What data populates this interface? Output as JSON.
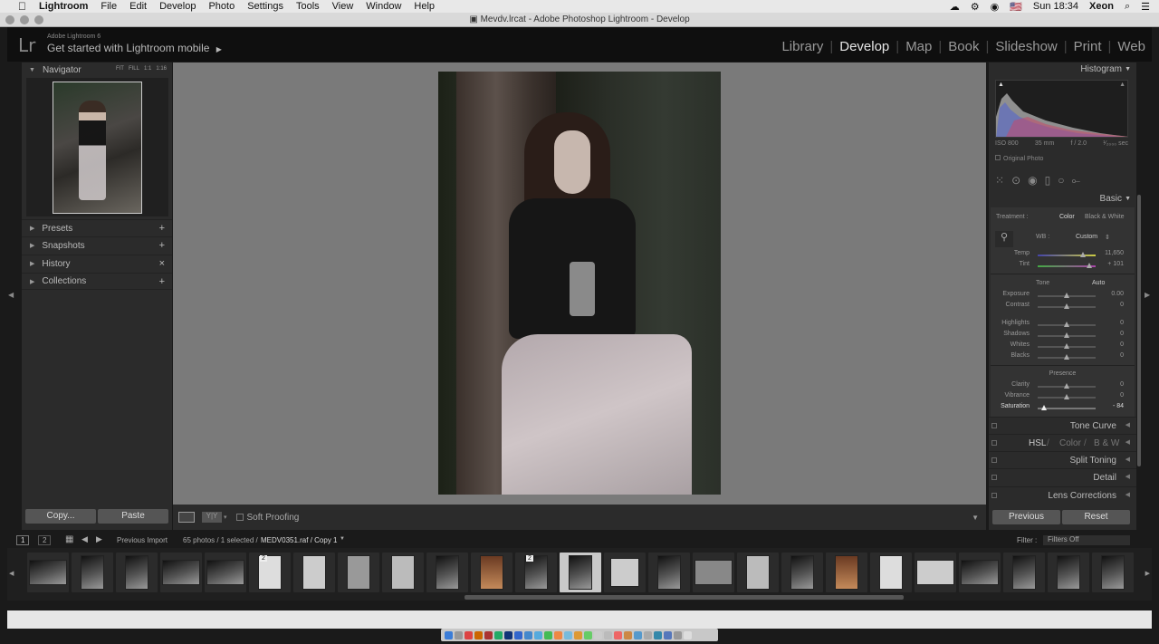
{
  "menubar": {
    "items": [
      "Lightroom",
      "File",
      "Edit",
      "Develop",
      "Photo",
      "Settings",
      "Tools",
      "View",
      "Window",
      "Help"
    ],
    "clock": "Sun 18:34",
    "user": "Xeon"
  },
  "window": {
    "title": "Mevdv.lrcat - Adobe Photoshop Lightroom - Develop"
  },
  "identity": {
    "logo": "Lr",
    "small": "Adobe Lightroom 6",
    "big": "Get started with Lightroom mobile"
  },
  "modules": [
    "Library",
    "Develop",
    "Map",
    "Book",
    "Slideshow",
    "Print",
    "Web"
  ],
  "navigator": {
    "title": "Navigator",
    "opts": [
      "FIT",
      "FILL",
      "1:1",
      "1:16"
    ]
  },
  "left_sections": [
    {
      "label": "Presets",
      "action": "+"
    },
    {
      "label": "Snapshots",
      "action": "+"
    },
    {
      "label": "History",
      "action": "×"
    },
    {
      "label": "Collections",
      "action": "+"
    }
  ],
  "left_buttons": {
    "copy": "Copy...",
    "paste": "Paste"
  },
  "toolbar": {
    "soft_proofing": "Soft Proofing"
  },
  "histogram": {
    "title": "Histogram",
    "iso": "ISO 800",
    "focal": "35 mm",
    "aperture": "f / 2.0",
    "shutter": "¹⁄₂₀₀₀ sec",
    "original": "Original Photo"
  },
  "basic": {
    "title": "Basic",
    "treatment_label": "Treatment :",
    "treatment_color": "Color",
    "treatment_bw": "Black & White",
    "wb_label": "WB :",
    "wb_value": "Custom",
    "temp": {
      "label": "Temp",
      "value": "11,650"
    },
    "tint": {
      "label": "Tint",
      "value": "+ 101"
    },
    "tone_label": "Tone",
    "auto": "Auto",
    "exposure": {
      "label": "Exposure",
      "value": "0.00"
    },
    "contrast": {
      "label": "Contrast",
      "value": "0"
    },
    "highlights": {
      "label": "Highlights",
      "value": "0"
    },
    "shadows": {
      "label": "Shadows",
      "value": "0"
    },
    "whites": {
      "label": "Whites",
      "value": "0"
    },
    "blacks": {
      "label": "Blacks",
      "value": "0"
    },
    "presence_label": "Presence",
    "clarity": {
      "label": "Clarity",
      "value": "0"
    },
    "vibrance": {
      "label": "Vibrance",
      "value": "0"
    },
    "saturation": {
      "label": "Saturation",
      "value": "- 84"
    }
  },
  "right_sections": {
    "tone_curve": "Tone Curve",
    "hsl": "HSL",
    "hsl_color": "Color",
    "hsl_bw": "B & W",
    "split_toning": "Split Toning",
    "detail": "Detail",
    "lens": "Lens Corrections"
  },
  "right_buttons": {
    "previous": "Previous",
    "reset": "Reset"
  },
  "filmbar": {
    "screen1": "1",
    "screen2": "2",
    "source": "Previous Import",
    "count": "65 photos / 1 selected /",
    "file": "MEDV0351.raf / Copy 1",
    "filter_label": "Filter :",
    "filter_value": "Filters Off"
  },
  "film_badges": {
    "b1": "2",
    "b2": "2"
  }
}
